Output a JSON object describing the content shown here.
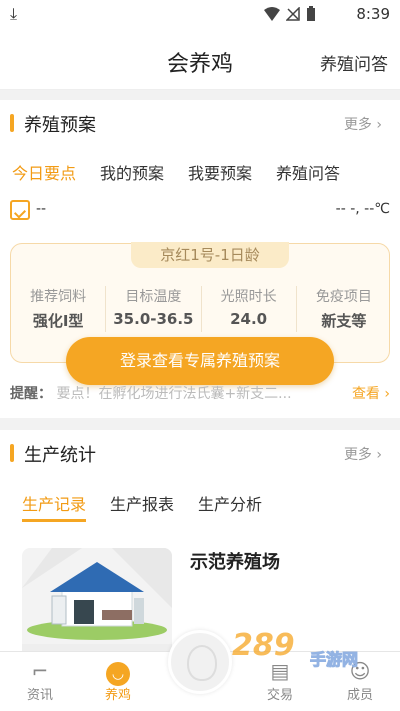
{
  "status": {
    "time": "8:39"
  },
  "header": {
    "title": "会养鸡",
    "right_link": "养殖问答"
  },
  "plan_section": {
    "title": "养殖预案",
    "more": "更多",
    "tabs": [
      "今日要点",
      "我的预案",
      "我要预案",
      "养殖问答"
    ],
    "date_value": "--",
    "temperature": "-- -, --℃",
    "plan_label": "京红1号-1日龄",
    "metrics": [
      {
        "key": "推荐饲料",
        "value": "强化Ⅰ型"
      },
      {
        "key": "目标温度",
        "value": "35.0-36.5"
      },
      {
        "key": "光照时长",
        "value": "24.0"
      },
      {
        "key": "免疫项目",
        "value": "新支等"
      }
    ],
    "login_button": "登录查看专属养殖预案",
    "tip_label": "提醒：",
    "tip_text": "要点！在孵化场进行法氏囊+新支二...",
    "tip_link": "查看"
  },
  "stats_section": {
    "title": "生产统计",
    "more": "更多",
    "tabs": [
      "生产记录",
      "生产报表",
      "生产分析"
    ],
    "farm_name": "示范养殖场"
  },
  "bottom_nav": {
    "items": [
      {
        "label": "资讯",
        "icon": "news-icon"
      },
      {
        "label": "养鸡",
        "icon": "chicken-icon"
      },
      {
        "label": "交易",
        "icon": "trade-icon"
      },
      {
        "label": "成员",
        "icon": "member-icon"
      }
    ]
  },
  "watermark": {
    "main": "289",
    "sub": "手游网"
  },
  "colors": {
    "accent": "#f5a623",
    "active_text": "#f29b14"
  }
}
